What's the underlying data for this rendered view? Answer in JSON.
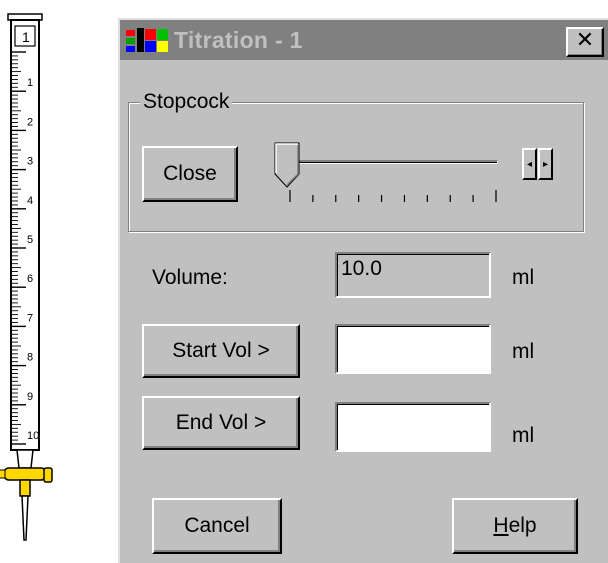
{
  "burette": {
    "top_label": "1",
    "scale_labels": [
      "1",
      "2",
      "3",
      "4",
      "5",
      "6",
      "7",
      "8",
      "9",
      "10"
    ],
    "colors": {
      "stopcock": "#ffd700",
      "tube": "#ffffff",
      "markings": "#000000"
    }
  },
  "window": {
    "title": "Titration - 1",
    "icon": "windows-logo-icon",
    "close_label": "✕"
  },
  "stopcock": {
    "group_label": "Stopcock",
    "toggle_button_label": "Close",
    "slider_level": 0,
    "tick_count": 10,
    "spin_left": "◂",
    "spin_right": "▸"
  },
  "volume": {
    "label": "Volume:",
    "value": "10.0",
    "unit": "ml"
  },
  "start_vol": {
    "button_label": "Start Vol >",
    "value": "",
    "unit": "ml"
  },
  "end_vol": {
    "button_label": "End Vol >",
    "value": "",
    "unit": "ml"
  },
  "footer": {
    "cancel_label": "Cancel",
    "help_hotkey": "H",
    "help_rest": "elp"
  }
}
